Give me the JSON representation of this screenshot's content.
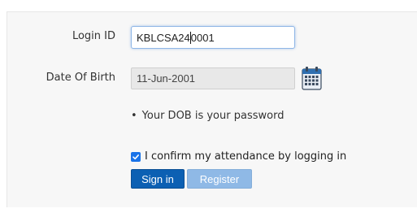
{
  "form": {
    "login_label": "Login ID",
    "login_value_left": "KBLCSA24",
    "login_value_right": "0001",
    "dob_label": "Date Of Birth",
    "dob_value": "11-Jun-2001",
    "hint": "Your DOB is your password",
    "hint_bullet": "•",
    "confirm_label": "I confirm my attendance by logging in",
    "confirm_checked": true,
    "signin_label": "Sign in",
    "register_label": "Register"
  },
  "icons": {
    "calendar": "calendar-icon",
    "checkbox": "checkmark-icon"
  },
  "colors": {
    "primary_button": "#0c60b3",
    "secondary_button": "#8fb9e6",
    "focus_border": "#8fb6e6",
    "checkbox": "#1a73e8"
  }
}
